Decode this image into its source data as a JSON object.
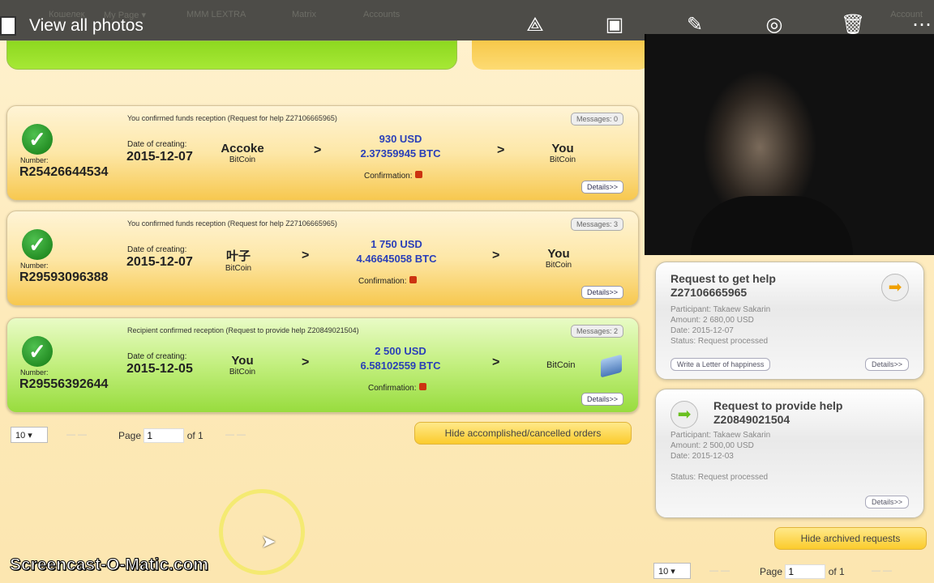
{
  "viewer": {
    "title": "View all photos",
    "ghost_tabs": [
      "Кошелек",
      "My Page ▾",
      "MMM LEXTRA",
      "Matrix",
      "Accounts"
    ],
    "ghost_account": "Account"
  },
  "orders": [
    {
      "status": "You confirmed funds reception (Request for help Z27106665965)",
      "messages": "Messages: 0",
      "number_label": "Number:",
      "number": "R25426644534",
      "date_label": "Date of creating:",
      "date": "2015-12-07",
      "from": "Accoke",
      "from_sub": "BitCoin",
      "usd": "930 USD",
      "btc": "2.37359945 BTC",
      "confirmation": "Confirmation:",
      "to": "You",
      "to_sub": "BitCoin",
      "details": "Details>>"
    },
    {
      "status": "You confirmed funds reception (Request for help Z27106665965)",
      "messages": "Messages: 3",
      "number_label": "Number:",
      "number": "R29593096388",
      "date_label": "Date of creating:",
      "date": "2015-12-07",
      "from": "叶子",
      "from_sub": "BitCoin",
      "usd": "1 750 USD",
      "btc": "4.46645058 BTC",
      "confirmation": "Confirmation:",
      "to": "You",
      "to_sub": "BitCoin",
      "details": "Details>>"
    },
    {
      "status": "Recipient confirmed reception (Request to provide help Z20849021504)",
      "messages": "Messages: 2",
      "number_label": "Number:",
      "number": "R29556392644",
      "date_label": "Date of creating:",
      "date": "2015-12-05",
      "from": "You",
      "from_sub": "BitCoin",
      "usd": "2 500 USD",
      "btc": "6.58102559 BTC",
      "confirmation": "Confirmation:",
      "to_sub": "BitCoin",
      "details": "Details>>"
    }
  ],
  "arrow": ">",
  "pagination": {
    "per_page": "10 ▾",
    "page_label": "Page",
    "page": "1",
    "of": "of 1",
    "dash": "— —"
  },
  "hide_orders": "Hide accomplished/cancelled orders",
  "requests": [
    {
      "title": "Request to get help",
      "id": "Z27106665965",
      "participant": "Participant: Takaew Sakarin",
      "amount": "Amount: 2 680,00 USD",
      "date": "Date: 2015-12-07",
      "status": "Status: Request processed",
      "letter": "Write a Letter of happiness",
      "details": "Details>>"
    },
    {
      "title": "Request to provide help",
      "id": "Z20849021504",
      "participant": "Participant: Takaew Sakarin",
      "amount": "Amount: 2 500,00 USD",
      "date": "Date: 2015-12-03",
      "status": "Status: Request processed",
      "details": "Details>>"
    }
  ],
  "hide_archived": "Hide archived requests",
  "watermark": "Screencast-O-Matic.com"
}
